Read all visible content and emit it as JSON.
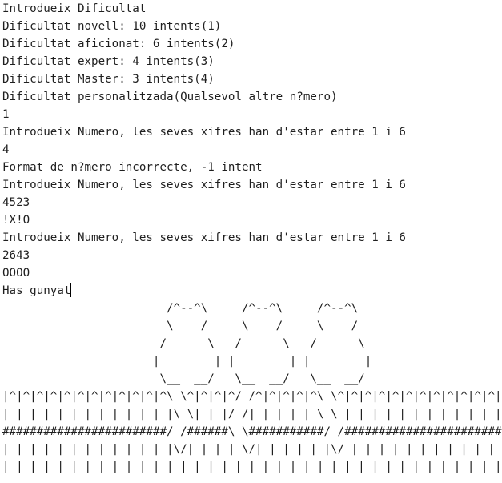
{
  "console": {
    "lines": [
      "Introdueix Dificultat",
      "Dificultat novell: 10 intents(1)",
      "Dificultat aficionat: 6 intents(2)",
      "Dificultat expert: 4 intents(3)",
      "Dificultat Master: 3 intents(4)",
      "Dificultat personalitzada(Qualsevol altre n?mero)",
      "1",
      "Introdueix Numero, les seves xifres han d'estar entre 1 i 6",
      "4",
      "Format de n?mero incorrecte, -1 intent",
      "Introdueix Numero, les seves xifres han d'estar entre 1 i 6",
      "4523",
      "!X!O",
      "Introdueix Numero, les seves xifres han d'estar entre 1 i 6",
      "2643",
      "OOOO",
      "Has gunyat"
    ],
    "art": [
      "                        /^--^\\     /^--^\\     /^--^\\",
      "                        \\____/     \\____/     \\____/",
      "                       /      \\   /      \\   /      \\",
      "                      |        | |        | |        |",
      "                       \\__  __/   \\__  __/   \\__  __/",
      "|^|^|^|^|^|^|^|^|^|^|^|^\\ \\^|^|^|^/ /^|^|^|^|^\\ \\^|^|^|^|^|^|^|^|^|^|^|^|",
      "| | | | | | | | | | | | |\\ \\| | |/ /| | | | | \\ \\ | | | | | | | | | | | |",
      "########################/ /######\\ \\###########/ /#######################",
      "| | | | | | | | | | | | |\\/| | | | \\/| | | | | |\\/ | | | | | | | | | | | |",
      "|_|_|_|_|_|_|_|_|_|_|_|_|_|_|_|_|_|_|_|_|_|_|_|_|_|_|_|_|_|_|_|_|_|_|_|_|"
    ]
  }
}
